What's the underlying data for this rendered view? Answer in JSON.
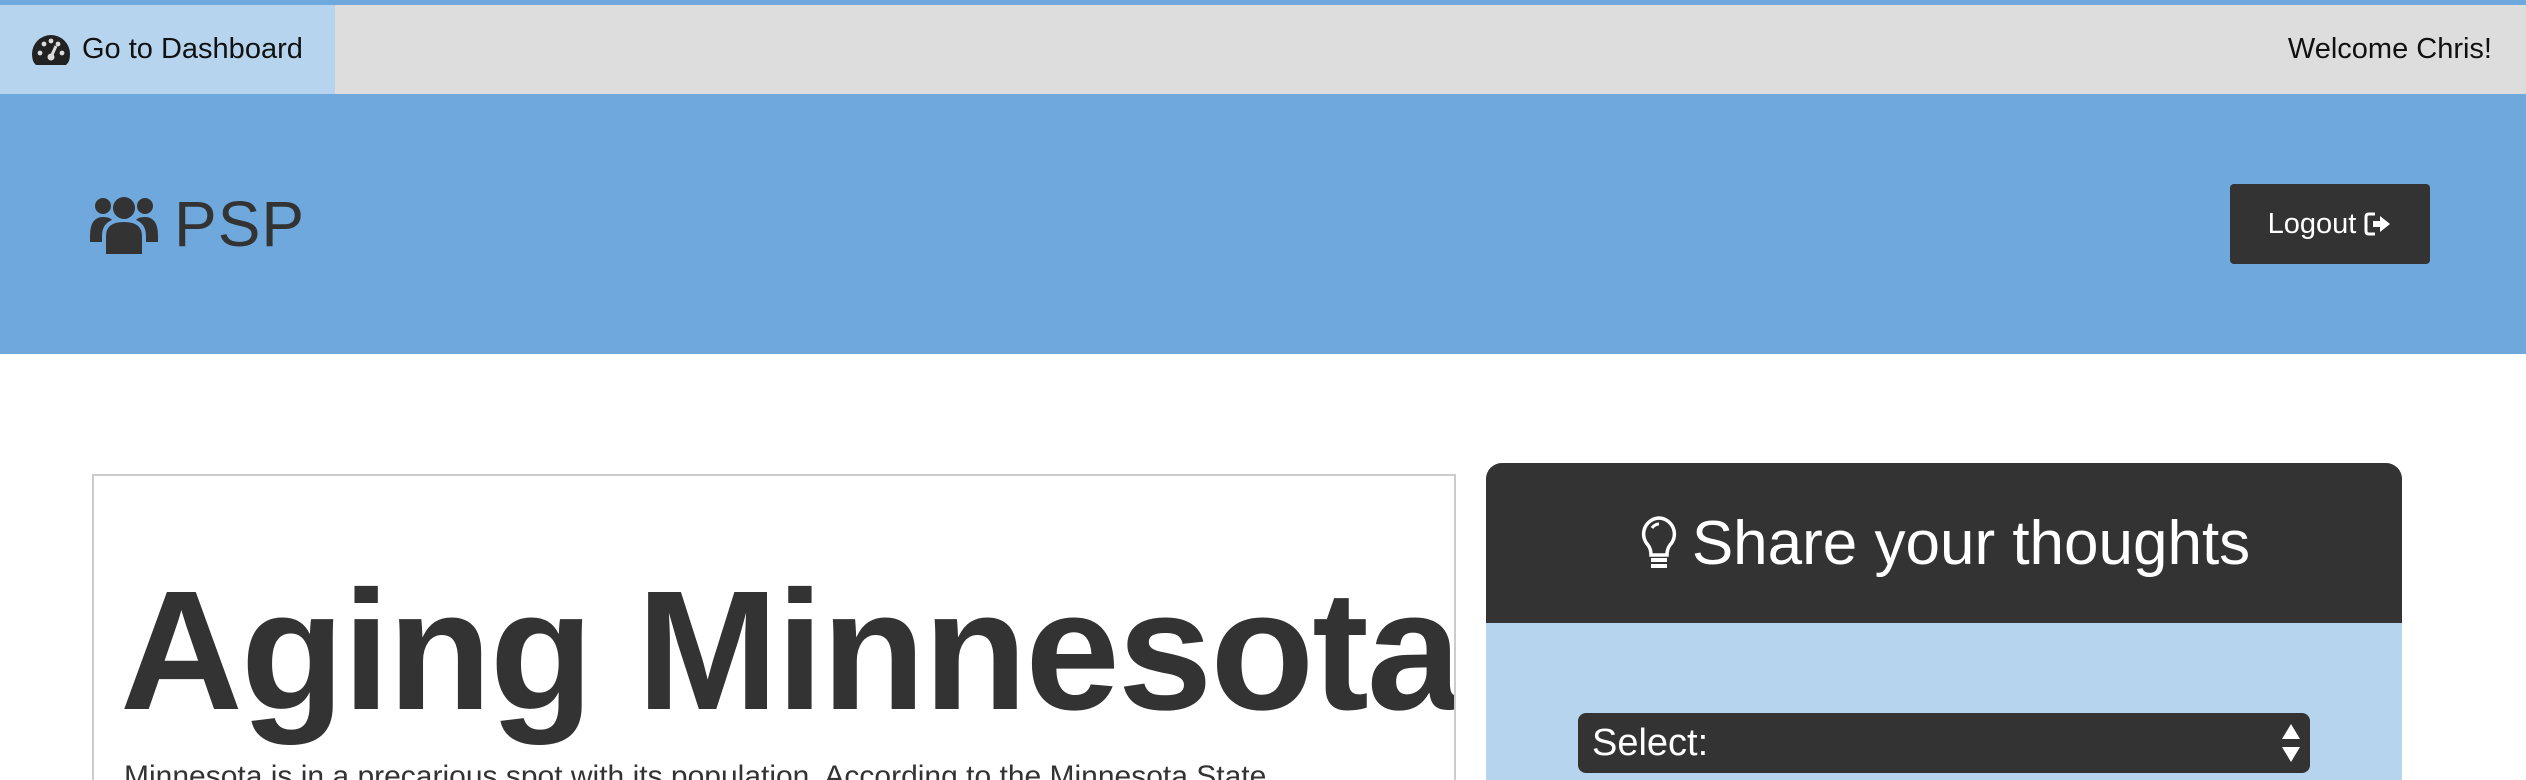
{
  "topbar": {
    "dashboard_label": "Go to Dashboard",
    "welcome_text": "Welcome Chris!",
    "dashboard_icon": "tachometer-icon"
  },
  "header": {
    "brand": "PSP",
    "brand_icon": "users-icon",
    "logout_label": "Logout",
    "logout_icon": "sign-out-icon"
  },
  "article": {
    "title": "Aging Minnesota",
    "intro": "Minnesota is in a precarious spot with its population. According to the Minnesota State"
  },
  "share": {
    "title": "Share your thoughts",
    "title_icon": "lightbulb-icon",
    "select_value": "Select:"
  },
  "colors": {
    "accent_blue": "#6fa8dc",
    "light_blue": "#b7d4ee",
    "dark": "#333333",
    "topbar_gray": "#dddddd"
  }
}
